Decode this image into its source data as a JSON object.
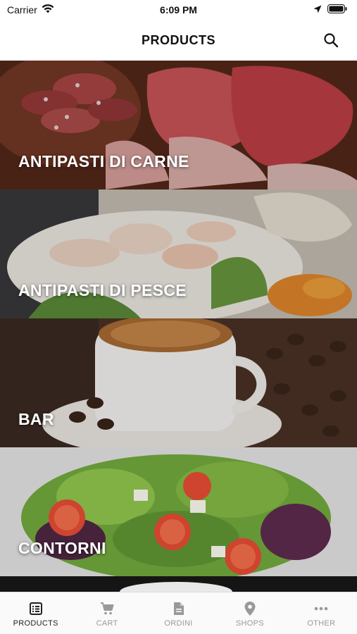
{
  "status_bar": {
    "carrier": "Carrier",
    "time": "6:09 PM"
  },
  "header": {
    "title": "PRODUCTS",
    "search_icon": "search-icon"
  },
  "categories": [
    {
      "label": "ANTIPASTI DI CARNE"
    },
    {
      "label": "ANTIPASTI DI PESCE"
    },
    {
      "label": "BAR"
    },
    {
      "label": "CONTORNI"
    }
  ],
  "tab_bar": {
    "items": [
      {
        "label": "PRODUCTS",
        "icon": "list-icon",
        "active": true
      },
      {
        "label": "CART",
        "icon": "cart-icon",
        "active": false
      },
      {
        "label": "ORDINI",
        "icon": "document-icon",
        "active": false
      },
      {
        "label": "SHOPS",
        "icon": "location-pin-icon",
        "active": false
      },
      {
        "label": "OTHER",
        "icon": "more-icon",
        "active": false
      }
    ]
  },
  "colors": {
    "active_tab": "#222222",
    "inactive_tab": "#999999"
  }
}
